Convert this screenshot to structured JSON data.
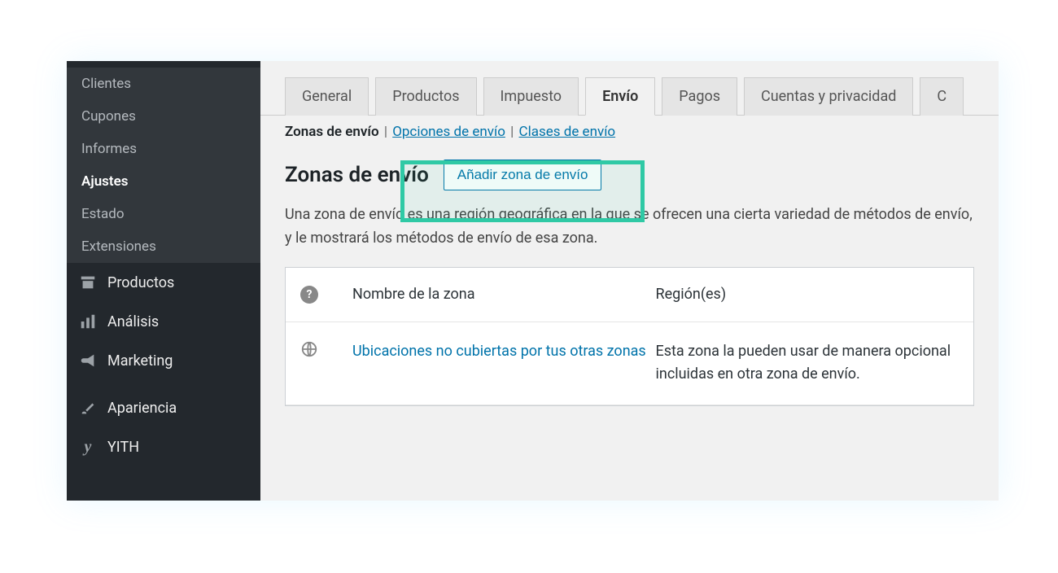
{
  "sidebar": {
    "sub_items": [
      "Clientes",
      "Cupones",
      "Informes",
      "Ajustes",
      "Estado",
      "Extensiones"
    ],
    "active_sub": "Ajustes",
    "main_items": [
      {
        "label": "Productos",
        "icon": "archive"
      },
      {
        "label": "Análisis",
        "icon": "chart"
      },
      {
        "label": "Marketing",
        "icon": "megaphone"
      },
      {
        "label": "Apariencia",
        "icon": "brush"
      },
      {
        "label": "YITH",
        "icon": "yith"
      }
    ]
  },
  "tabs": [
    "General",
    "Productos",
    "Impuesto",
    "Envío",
    "Pagos",
    "Cuentas y privacidad",
    "C"
  ],
  "active_tab": "Envío",
  "subtabs": {
    "active": "Zonas de envío",
    "links": [
      "Opciones de envío",
      "Clases de envío"
    ]
  },
  "section": {
    "title": "Zonas de envío",
    "add_button": "Añadir zona de envío",
    "description": "Una zona de envío es una región geográfica en la que se ofrecen una cierta variedad de métodos de envío, y le mostrará los métodos de envío de esa zona."
  },
  "table": {
    "headers": [
      "Nombre de la zona",
      "Región(es)"
    ],
    "row": {
      "name": "Ubicaciones no cubiertas por tus otras zonas",
      "region": "Esta zona la pueden usar de manera opcional incluidas en otra zona de envío."
    }
  }
}
